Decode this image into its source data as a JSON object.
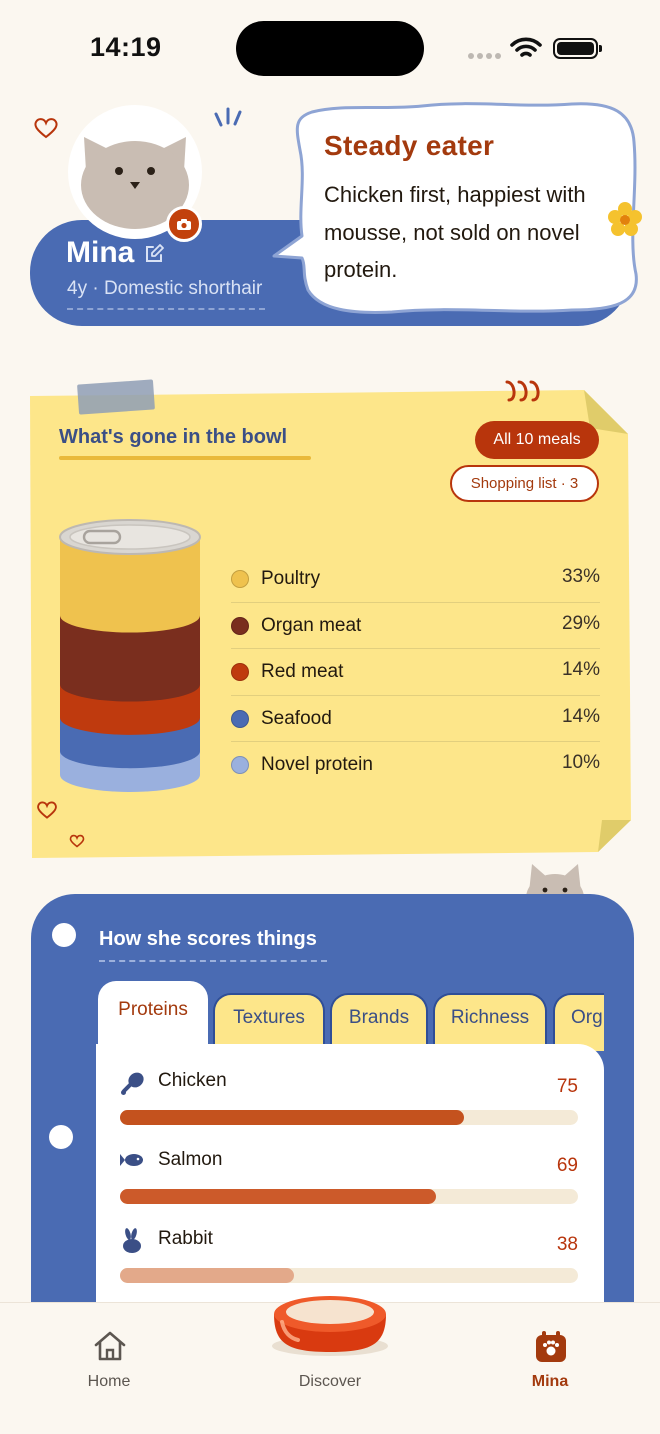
{
  "status_bar": {
    "time": "14:19"
  },
  "profile": {
    "name": "Mina",
    "subtitle": "4y · Domestic shorthair",
    "bubble_title": "Steady eater",
    "bubble_text": "Chicken first, happiest with mousse, not sold on novel protein."
  },
  "bowl": {
    "title": "What's gone in the bowl",
    "meals_button": "All 10 meals",
    "shopping_button": "Shopping list · 3",
    "legend": [
      {
        "name": "Poultry",
        "percent": "33%",
        "value": 33,
        "color": "#EFC24E"
      },
      {
        "name": "Organ meat",
        "percent": "29%",
        "value": 29,
        "color": "#7A2E1E"
      },
      {
        "name": "Red meat",
        "percent": "14%",
        "value": 14,
        "color": "#BF3A0E"
      },
      {
        "name": "Seafood",
        "percent": "14%",
        "value": 14,
        "color": "#4A6BB3"
      },
      {
        "name": "Novel protein",
        "percent": "10%",
        "value": 10,
        "color": "#9AB0DE"
      }
    ]
  },
  "scores": {
    "title": "How she scores things",
    "tabs": [
      "Proteins",
      "Textures",
      "Brands",
      "Richness",
      "Org"
    ],
    "active_tab": "Proteins",
    "items": [
      {
        "name": "Chicken",
        "score": "75",
        "value": 75,
        "icon": "drumstick-icon"
      },
      {
        "name": "Salmon",
        "score": "69",
        "value": 69,
        "icon": "fish-icon"
      },
      {
        "name": "Rabbit",
        "score": "38",
        "value": 38,
        "icon": "rabbit-icon"
      }
    ]
  },
  "nav": {
    "home": "Home",
    "discover": "Discover",
    "profile": "Mina",
    "active": "Mina"
  },
  "colors": {
    "accent_blue": "#4A6BB3",
    "accent_rust": "#B8350C",
    "paper_yellow": "#FDE68A"
  }
}
